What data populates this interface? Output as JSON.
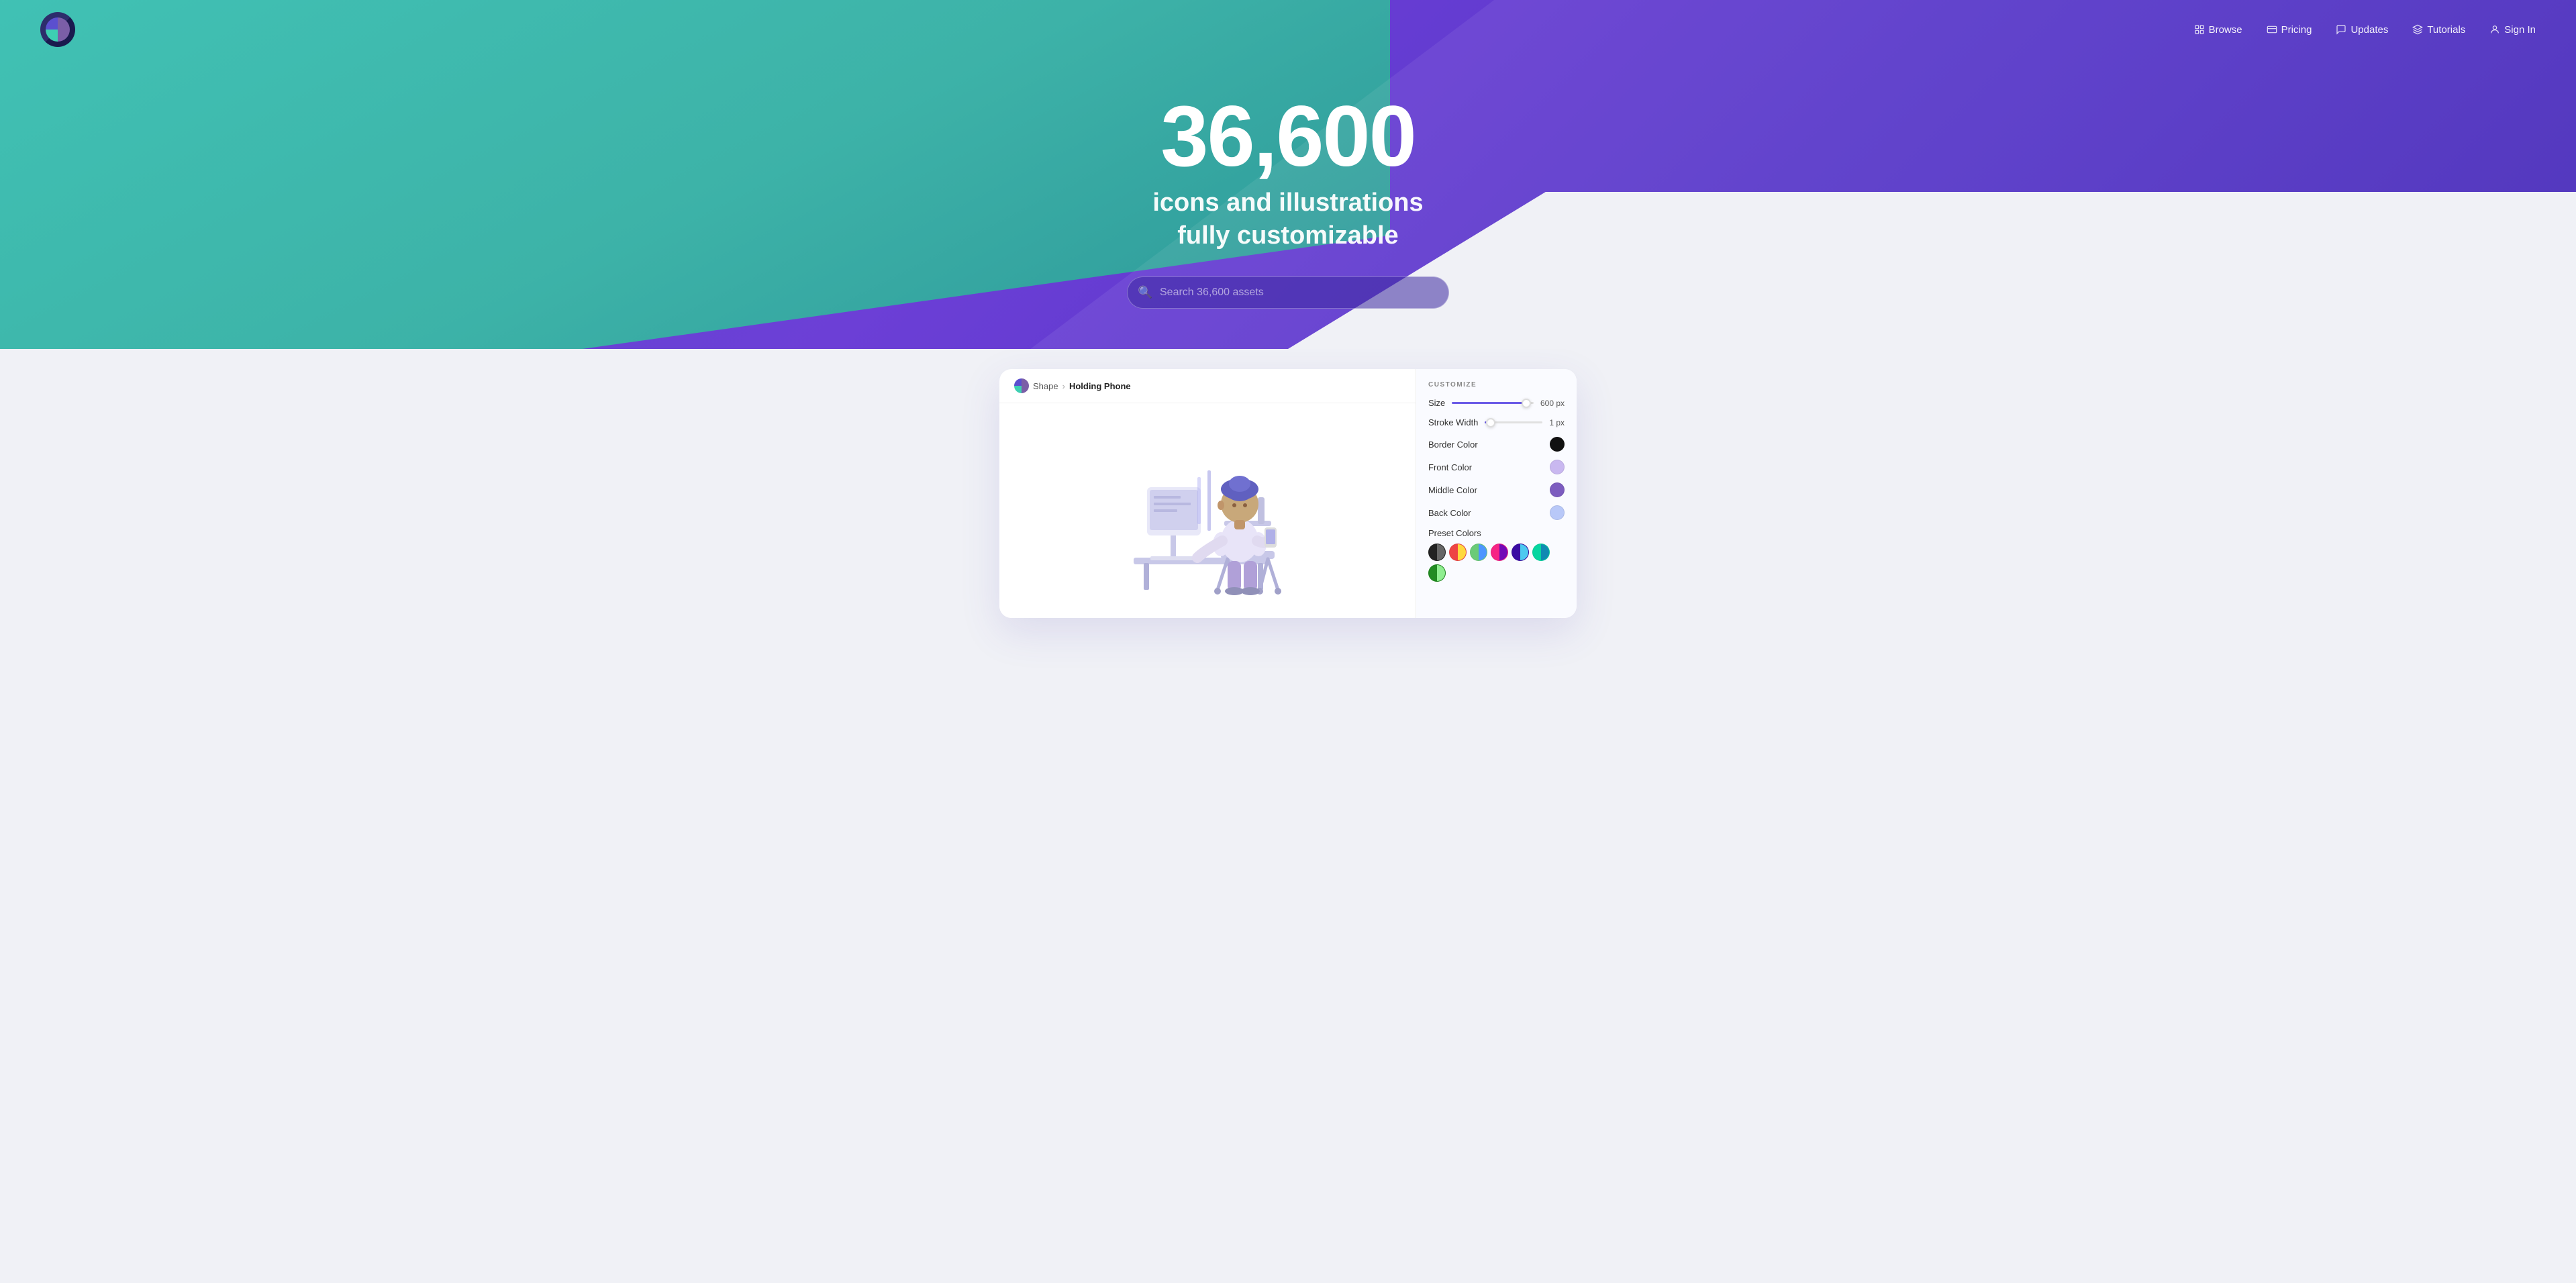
{
  "nav": {
    "logo_alt": "Streamline Icons",
    "links": [
      {
        "label": "Browse",
        "icon": "browse-icon"
      },
      {
        "label": "Pricing",
        "icon": "pricing-icon"
      },
      {
        "label": "Updates",
        "icon": "updates-icon"
      },
      {
        "label": "Tutorials",
        "icon": "tutorials-icon"
      },
      {
        "label": "Sign In",
        "icon": "signin-icon"
      }
    ]
  },
  "hero": {
    "count": "36,600",
    "line1": "icons and illustrations",
    "line2": "fully customizable",
    "search_placeholder": "Search 36,600 assets"
  },
  "demo": {
    "breadcrumb_shape": "Shape",
    "breadcrumb_sep": "›",
    "breadcrumb_current": "Holding Phone",
    "customize_title": "CUSTOMIZE",
    "size_label": "Size",
    "size_value": "600 px",
    "size_fill_pct": "90",
    "size_thumb_pct": "88",
    "stroke_label": "Stroke Width",
    "stroke_value": "1 px",
    "stroke_fill_pct": "5",
    "stroke_thumb_pct": "3",
    "border_color_label": "Border Color",
    "border_color": "#111111",
    "front_color_label": "Front Color",
    "front_color": "#c9b8f0",
    "middle_color_label": "Middle Color",
    "middle_color": "#7c5cbf",
    "back_color_label": "Back Color",
    "back_color": "#b8c8f8",
    "preset_title": "Preset Colors",
    "presets": [
      {
        "left": "#222",
        "right": "#888"
      },
      {
        "left": "#ff6b6b",
        "right": "#ffd93d"
      },
      {
        "left": "#6bcb77",
        "right": "#4d96ff"
      },
      {
        "left": "#f72585",
        "right": "#7209b7"
      },
      {
        "left": "#3a0ca3",
        "right": "#4cc9f0"
      },
      {
        "left": "#06d6a0",
        "right": "#118ab2"
      },
      {
        "left": "#ffd166",
        "right": "#ef476f"
      }
    ]
  }
}
